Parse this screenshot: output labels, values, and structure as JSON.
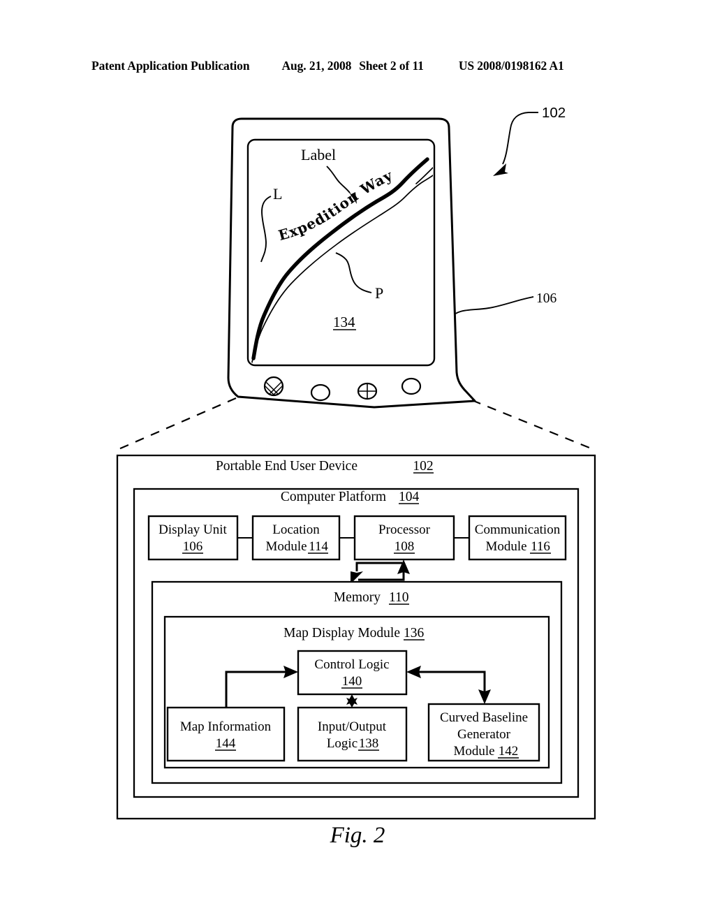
{
  "header": {
    "publication": "Patent Application Publication",
    "date": "Aug. 21, 2008",
    "sheet": "Sheet 2 of 11",
    "patent_number": "US 2008/0198162 A1"
  },
  "figure": {
    "caption": "Fig. 2"
  },
  "device": {
    "ref_device": "102",
    "ref_display": "106",
    "screen": {
      "ref_map": "134",
      "annotation_label": "Label",
      "annotation_baseline": "L",
      "annotation_path": "P",
      "curved_label_text": "Expedition Way"
    },
    "buttons": [
      {
        "name": "hatched-button"
      },
      {
        "name": "plain-button-1"
      },
      {
        "name": "crosshair-button"
      },
      {
        "name": "plain-button-2"
      }
    ]
  },
  "block_diagram": {
    "outer": {
      "title": "Portable End User Device",
      "ref": "102"
    },
    "platform": {
      "title": "Computer  Platform",
      "ref": "104"
    },
    "row_modules": [
      {
        "line1": "Display Unit",
        "line2": "",
        "ref": "106",
        "ref_on_line": 2
      },
      {
        "line1": "Location",
        "line2": "Module",
        "ref": "114",
        "ref_on_line": 2
      },
      {
        "line1": "Processor",
        "line2": "",
        "ref": "108",
        "ref_on_line": 2
      },
      {
        "line1": "Communication",
        "line2": "Module",
        "ref": "116",
        "ref_on_line": 2
      }
    ],
    "memory": {
      "title": "Memory",
      "ref": "110"
    },
    "map_display_module": {
      "title": "Map Display Module",
      "ref": "136"
    },
    "control_logic": {
      "line1": "Control Logic",
      "ref": "140"
    },
    "sub_modules": [
      {
        "line1": "Map Information",
        "line2": "",
        "line3": "",
        "ref": "144"
      },
      {
        "line1": "Input/Output",
        "line2": "Logic",
        "line3": "",
        "ref": "138"
      },
      {
        "line1": "Curved Baseline",
        "line2": "Generator",
        "line3": "Module",
        "ref": "142"
      }
    ]
  }
}
